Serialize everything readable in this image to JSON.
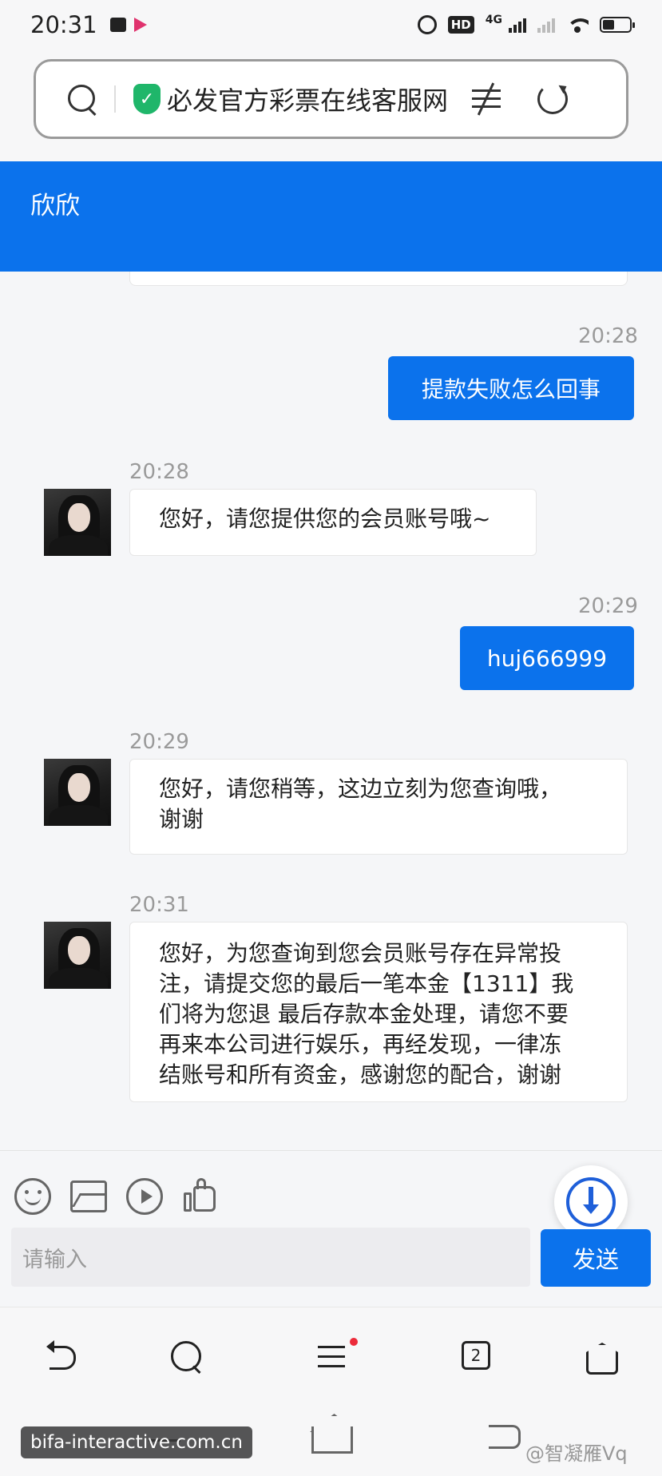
{
  "status_bar": {
    "time": "20:31",
    "hd_label": "HD",
    "network_label": "4G"
  },
  "browser": {
    "url_title": "必发官方彩票在线客服网"
  },
  "chat": {
    "agent_name": "欣欣",
    "messages": [
      {
        "direction": "out",
        "time": "20:28",
        "text": "提款失败怎么回事"
      },
      {
        "direction": "in",
        "time": "20:28",
        "text": "您好，请您提供您的会员账号哦~"
      },
      {
        "direction": "out",
        "time": "20:29",
        "text": "huj666999"
      },
      {
        "direction": "in",
        "time": "20:29",
        "text": "您好，请您稍等，这边立刻为您查询哦，\n谢谢"
      },
      {
        "direction": "in",
        "time": "20:31",
        "text": "您好，为您查询到您会员账号存在异常投\n注，请提交您的最后一笔本金【1311】我\n们将为您退 最后存款本金处理，请您不要\n再来本公司进行娱乐，再经发现，一律冻\n结账号和所有资金，感谢您的配合，谢谢"
      }
    ]
  },
  "composer": {
    "placeholder": "请输入",
    "send_label": "发送"
  },
  "browser_nav": {
    "tab_count": "2"
  },
  "watermarks": {
    "left": "bifa-interactive.com.cn",
    "right": "@智凝雁Vq"
  },
  "colors": {
    "accent": "#0b72ec",
    "shield": "#1fb66a",
    "badge": "#ec2b3a"
  }
}
